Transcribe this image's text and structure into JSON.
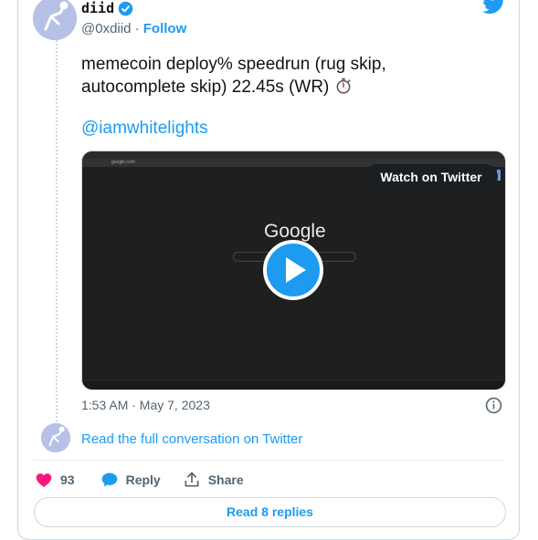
{
  "author": {
    "display_name": "diid",
    "handle": "@0xdiid",
    "separator": "·",
    "follow_label": "Follow"
  },
  "tweet": {
    "text": "memecoin deploy% speedrun (rug skip, autocomplete skip) 22.45s  (WR)",
    "mention": "@iamwhitelights",
    "timestamp": "1:53 AM · May 7, 2023"
  },
  "media": {
    "watch_label": "Watch on Twitter",
    "screen_logo": "Google",
    "screen_url": "google.com"
  },
  "conversation": {
    "read_full_label": "Read the full conversation on Twitter"
  },
  "actions": {
    "like_count": "93",
    "reply_label": "Reply",
    "share_label": "Share"
  },
  "replies_button_label": "Read 8 replies",
  "colors": {
    "accent": "#1d9bf0",
    "like": "#f91880",
    "text": "#0f1419",
    "muted": "#536471"
  },
  "icons": [
    "verified-badge-icon",
    "twitter-logo-icon",
    "stopwatch-icon",
    "play-icon",
    "info-icon",
    "heart-icon",
    "reply-bubble-icon",
    "share-icon"
  ]
}
